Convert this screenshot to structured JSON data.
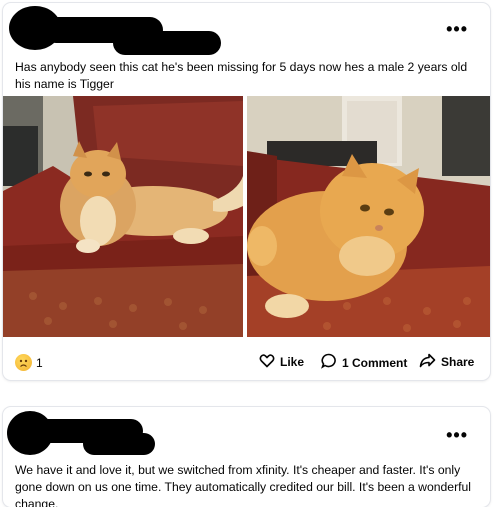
{
  "posts": [
    {
      "text": "Has anybody seen this cat he's been missing for 5 days now hes a male 2 years old his name is Tigger",
      "more_label": "•••",
      "reaction_count": "1",
      "actions": {
        "like": "Like",
        "comment": "1 Comment",
        "share": "Share"
      }
    },
    {
      "text": "We have it and love it, but we switched from xfinity. It's cheaper and faster. It's only gone down on us one time. They automatically credited our bill. It's been a wonderful change.",
      "more_label": "•••"
    }
  ],
  "icons": {
    "reaction": "sad-face-icon",
    "like": "thumbs-up-icon",
    "comment": "comment-bubble-icon",
    "share": "share-arrow-icon"
  },
  "colors": {
    "text": "#050505",
    "card_border": "#e4e6eb",
    "reaction_yellow": "#f2b233",
    "couch_red": "#8b2a21",
    "cat_orange": "#e3a04c"
  }
}
